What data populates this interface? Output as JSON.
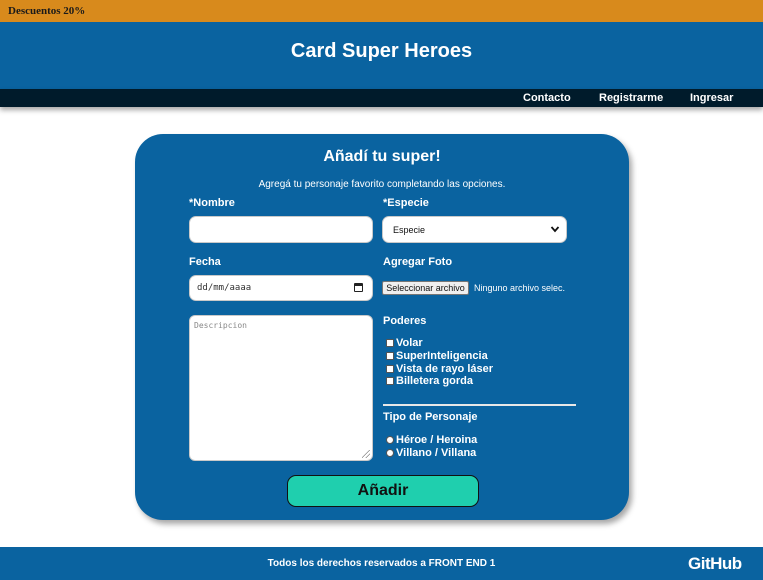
{
  "promo": {
    "text": "Descuentos 20%"
  },
  "header": {
    "title": "Card Super Heroes"
  },
  "nav": {
    "contact": "Contacto",
    "register": "Registrarme",
    "login": "Ingresar"
  },
  "form": {
    "title": "Añadí tu super!",
    "subtitle": "Agregá tu personaje favorito completando las opciones.",
    "name_label": "*Nombre",
    "name_value": "",
    "species_label": "*Especie",
    "species_selected": "Especie",
    "date_label": "Fecha",
    "date_placeholder": "dd/mm/aaaa",
    "photo_label": "Agregar Foto",
    "photo_button": "Seleccionar archivo",
    "photo_status": "Ninguno archivo selec.",
    "description_placeholder": "Descripcion",
    "powers_label": "Poderes",
    "powers": [
      {
        "label": "Volar",
        "checked": false
      },
      {
        "label": "SuperInteligencia",
        "checked": false
      },
      {
        "label": "Vista de rayo láser",
        "checked": false
      },
      {
        "label": "Billetera gorda",
        "checked": false
      }
    ],
    "type_label": "Tipo de Personaje",
    "types": [
      {
        "label": "Héroe / Heroina",
        "selected": false
      },
      {
        "label": "Villano / Villana",
        "selected": false
      }
    ],
    "submit_label": "Añadir"
  },
  "footer": {
    "text": "Todos los derechos reservados a FRONT END 1",
    "github": "GitHub"
  },
  "icons": {
    "chevron": "chevron-down-icon",
    "calendar": "calendar-icon",
    "github": "github-logo"
  },
  "colors": {
    "primary": "#0a63a0",
    "promo": "#d88a1c",
    "nav": "#001b2b",
    "accent_button": "#1fcfae"
  }
}
